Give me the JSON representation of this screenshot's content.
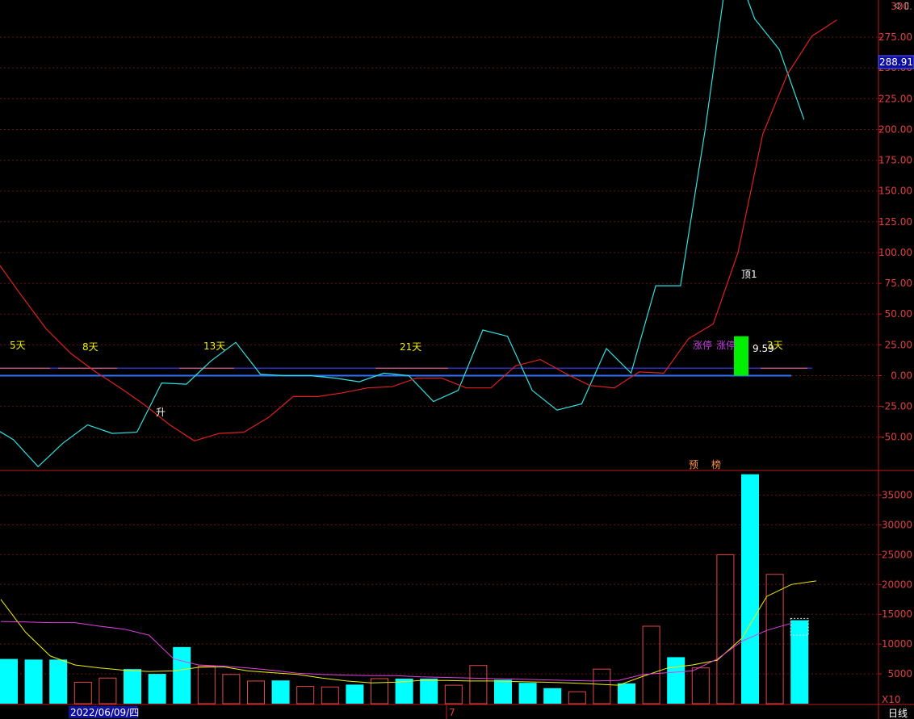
{
  "colors": {
    "background": "#000000",
    "axis": "#c01818",
    "grid": "#6a1010",
    "cyan": "#30e0e0",
    "red_line": "#e02020",
    "zero_line": "#3070ff",
    "blue_line": "#3030c0",
    "yellow": "#f0f000",
    "magenta": "#e040e0",
    "bar_up": "#e04848",
    "bar_down": "#00ffff",
    "highlight_bar": "#00ee00",
    "axis_text": "#e04040",
    "current_value_bg": "#1010a0"
  },
  "header": {
    "corner_icons": "◇ ▯"
  },
  "price_panel": {
    "current_value_tag": "288.91",
    "y_ticks": [
      "275.00",
      "250.00",
      "225.00",
      "200.00",
      "175.00",
      "150.00",
      "125.00",
      "100.00",
      "75.00",
      "50.00",
      "25.00",
      "0.00",
      "-25.00",
      "-50.00"
    ],
    "y_tick_values": [
      275,
      250,
      225,
      200,
      175,
      150,
      125,
      100,
      75,
      50,
      25,
      0,
      -25,
      -50
    ],
    "partial_top_tick": "300.",
    "ylim": [
      -62,
      300
    ],
    "cycle_labels": [
      "5天",
      "8天",
      "13天",
      "21天",
      "3天"
    ],
    "annotations": {
      "rise": "升",
      "top": "顶1",
      "limit_up_1": "涨停",
      "limit_up_2": "涨停",
      "value": "9.59",
      "pre": "预",
      "list": "榜"
    }
  },
  "volume_panel": {
    "y_ticks": [
      "35000",
      "30000",
      "25000",
      "20000",
      "15000",
      "10000",
      "5000"
    ],
    "y_tick_values": [
      35000,
      30000,
      25000,
      20000,
      15000,
      10000,
      5000
    ],
    "ylim": [
      0,
      39000
    ],
    "unit": "X10"
  },
  "footer": {
    "date": "2022/06/09/四",
    "month": "7",
    "period": "日线"
  },
  "chart_data": {
    "type": "line",
    "x": [
      1,
      2,
      3,
      4,
      5,
      6,
      7,
      8,
      9,
      10,
      11,
      12,
      13,
      14,
      15,
      16,
      17,
      18,
      19,
      20,
      21,
      22,
      23,
      24,
      25,
      26,
      27,
      28,
      29,
      30,
      31,
      32
    ],
    "series": [
      {
        "values": [
          -40,
          -52,
          -74,
          -55,
          -40,
          -47,
          -46,
          -6,
          -7,
          12,
          27,
          1,
          0,
          0,
          -2,
          -5,
          2,
          0,
          -21,
          -12,
          37,
          32,
          -12,
          -28,
          -23,
          22,
          2,
          73,
          73,
          200,
          345,
          290,
          265,
          208
        ]
      },
      {
        "values": [
          93,
          65,
          38,
          18,
          3,
          -10,
          -24,
          -40,
          -53,
          -47,
          -46,
          -34,
          -17,
          -17,
          -14,
          -10,
          -9,
          -2,
          -2,
          -10,
          -10,
          8,
          13,
          2,
          -8,
          -10,
          3,
          2,
          30,
          42,
          100,
          196,
          245,
          276,
          289
        ]
      },
      {
        "values": [
          7500,
          7400,
          7400,
          3600,
          4300,
          5800,
          5000,
          9500,
          6300,
          4900,
          3800,
          3900,
          2900,
          2800,
          3200,
          4200,
          4200,
          4200,
          3100,
          6400,
          4000,
          3500,
          2600,
          2000,
          5800,
          3400,
          13000,
          7800,
          6000,
          25000,
          38500,
          21700,
          14000
        ]
      },
      {
        "values": [
          17500,
          12000,
          8000,
          6500,
          6000,
          5600,
          5400,
          5500,
          6100,
          6200,
          5500,
          5200,
          4900,
          4300,
          3800,
          3500,
          3600,
          3900,
          3900,
          3800,
          3800,
          3700,
          3600,
          3500,
          3300,
          3100,
          4600,
          6000,
          6500,
          7300,
          11000,
          18000,
          20000,
          20600
        ]
      },
      {
        "values": [
          13800,
          13700,
          13600,
          13600,
          13000,
          12500,
          11500,
          7500,
          6500,
          6300,
          6000,
          5600,
          5100,
          4900,
          4800,
          4700,
          4700,
          4500,
          4400,
          4300,
          4200,
          4100,
          4000,
          3900,
          3800,
          3900,
          4900,
          5200,
          5500,
          7500,
          10500,
          12300,
          13500
        ]
      }
    ],
    "volume_up": [
      false,
      false,
      false,
      true,
      true,
      false,
      false,
      false,
      true,
      true,
      true,
      false,
      true,
      true,
      false,
      true,
      false,
      false,
      true,
      true,
      false,
      false,
      false,
      true,
      true,
      false,
      true,
      false,
      true,
      true,
      false,
      true,
      false
    ],
    "limit_up_bar": [
      0,
      32
    ]
  }
}
